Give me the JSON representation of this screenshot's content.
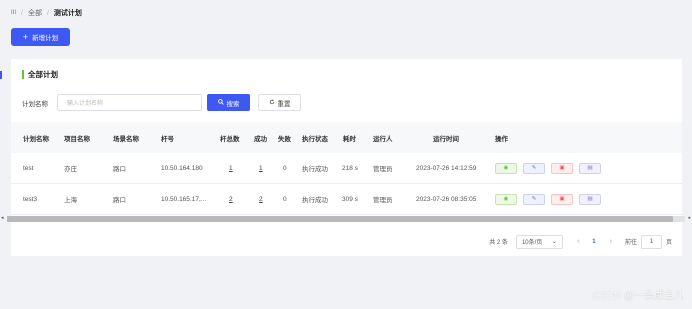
{
  "breadcrumb": {
    "home_icon": "menu-icon",
    "home": "III",
    "all": "全部",
    "current": "测试计划"
  },
  "add_button": "新增计划",
  "section_title": "全部计划",
  "search": {
    "label": "计划名称",
    "placeholder": "输入计划名称",
    "search_btn": "搜索",
    "reset_btn": "重置"
  },
  "table": {
    "columns": [
      "计划名称",
      "项目名称",
      "场景名称",
      "杆号",
      "杆总数",
      "成功",
      "失败",
      "执行状态",
      "耗时",
      "运行人",
      "运行时间",
      "操作"
    ],
    "rows": [
      {
        "name": "test",
        "project": "亦庄",
        "scene": "路口",
        "pole": "10.50.164.180",
        "total": "1",
        "success": "1",
        "fail": "0",
        "status": "执行成功",
        "duration": "218 s",
        "runner": "管理员",
        "time": "2023-07-26 14:12:59"
      },
      {
        "name": "test3",
        "project": "上海",
        "scene": "路口",
        "pole": "10.50.165.17,...",
        "total": "2",
        "success": "2",
        "fail": "0",
        "status": "执行成功",
        "duration": "309 s",
        "runner": "管理员",
        "time": "2023-07-26 08:35:05"
      }
    ]
  },
  "pagination": {
    "total": "共 2 条",
    "page_size": "10条/页",
    "current": "1",
    "goto": "前往",
    "goto_value": "1",
    "page_unit": "页"
  },
  "watermark": "CSDN @一条咸鱼儿",
  "colors": {
    "primary": "#3e58f3",
    "success": "#67c23a",
    "danger": "#e25656"
  }
}
